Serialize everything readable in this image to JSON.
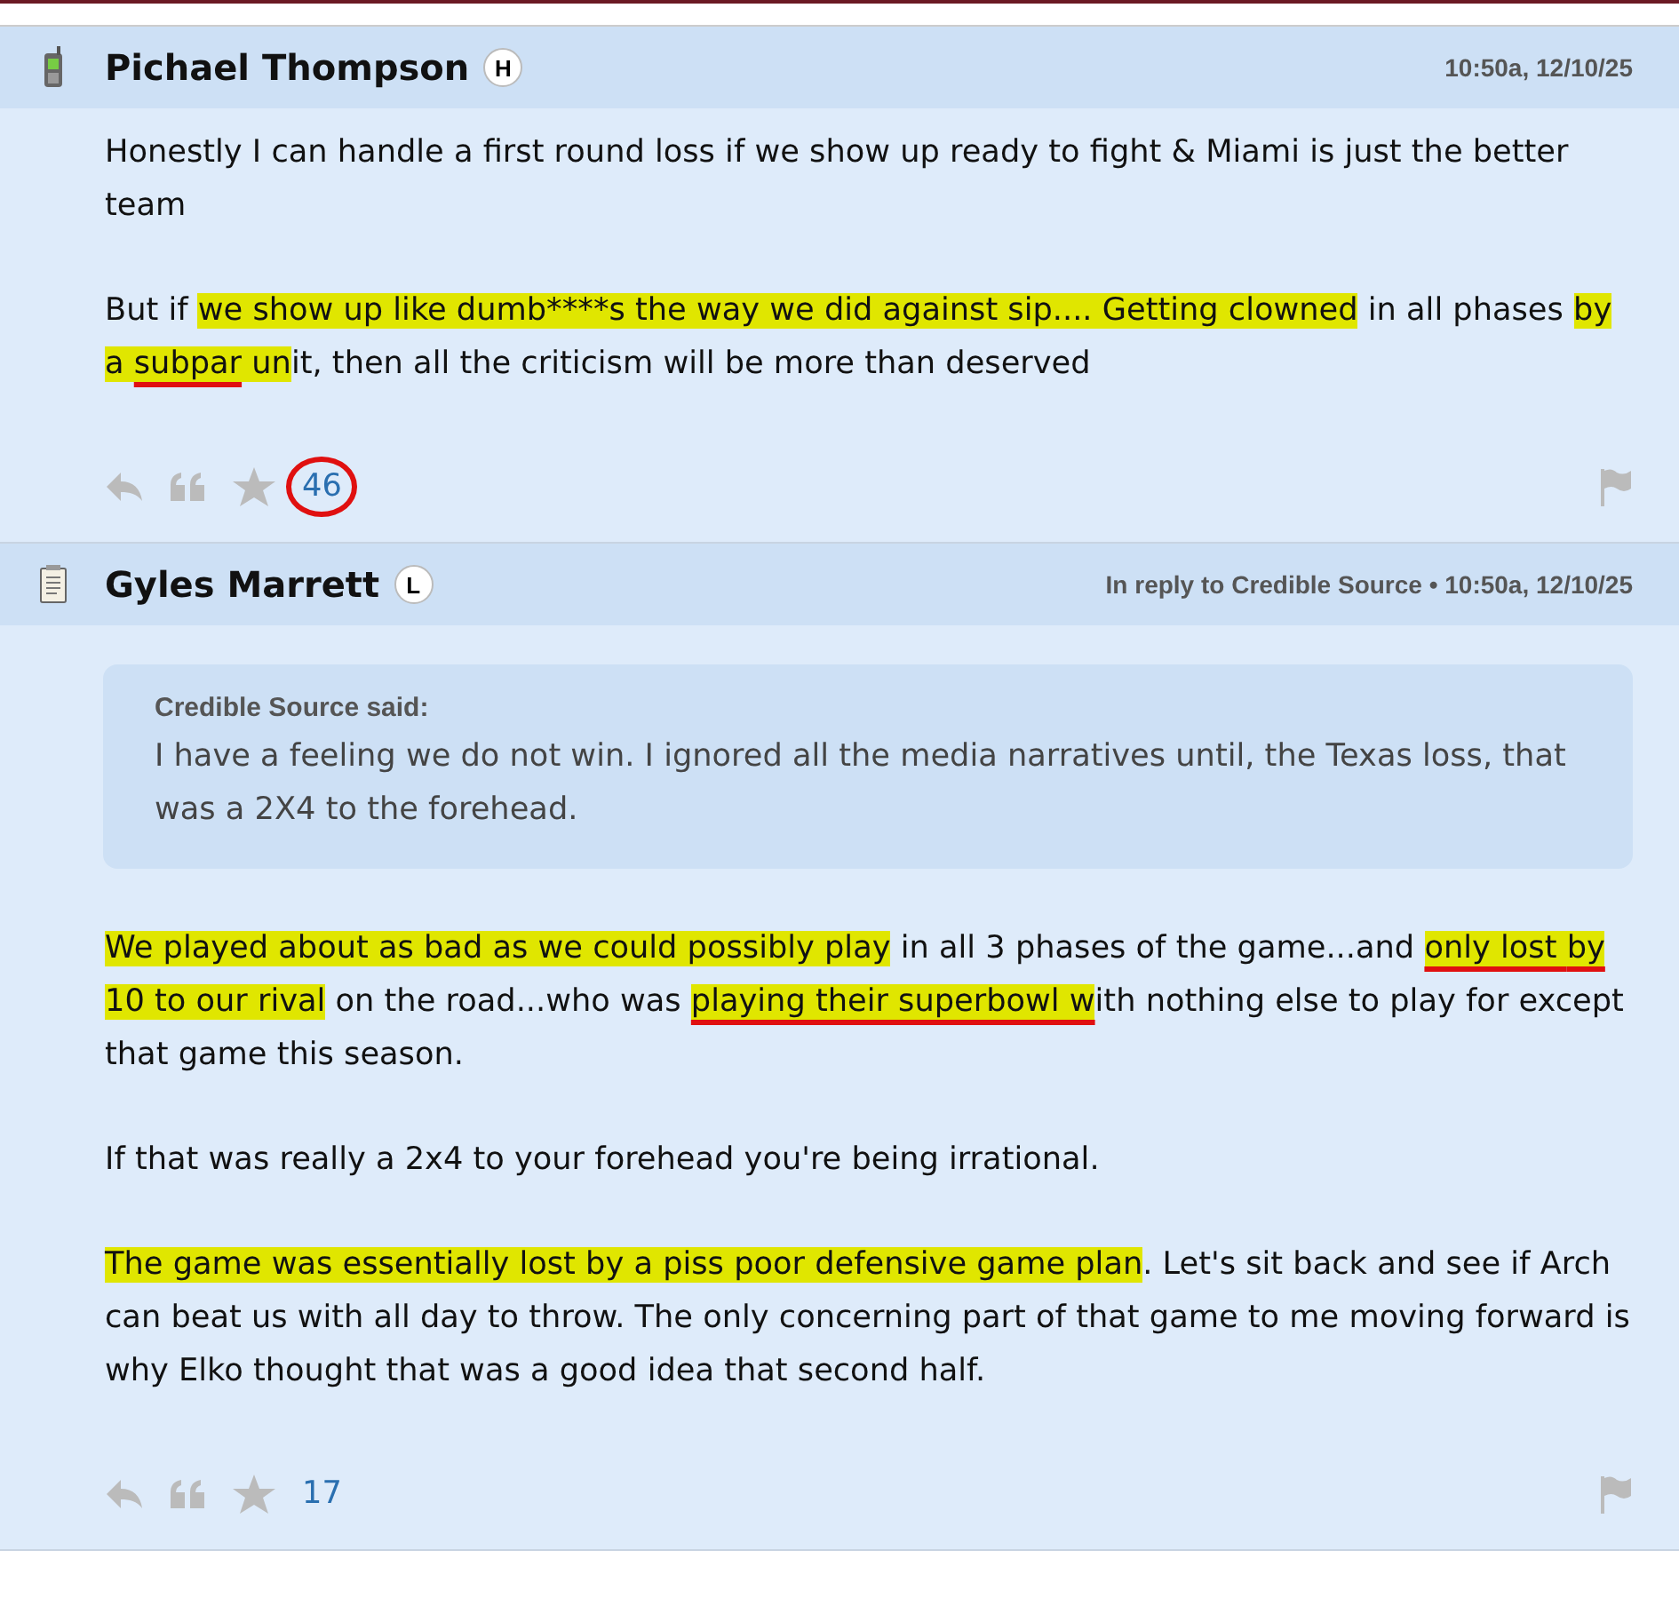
{
  "posts": [
    {
      "kind": "phone",
      "author": "Pichael Thompson",
      "badge": "H",
      "meta": "10:50a, 12/10/25",
      "paragraphs": [
        [
          {
            "text": "Honestly I can handle a first round loss if we show up ready to fight & Miami is just the better team",
            "highlight": false,
            "underline": false
          }
        ],
        [
          {
            "text": "But if ",
            "highlight": false,
            "underline": false
          },
          {
            "text": "we show up like dumb****s the way we did against sip.... ",
            "highlight": true,
            "underline": false
          },
          {
            "text": "Getting clowned",
            "highlight": true,
            "underline": false
          },
          {
            "text": " in all phases ",
            "highlight": false,
            "underline": false
          },
          {
            "text": "by a ",
            "highlight": true,
            "underline": false
          },
          {
            "text": "subpar",
            "highlight": true,
            "underline": true
          },
          {
            "text": " un",
            "highlight": true,
            "underline": false
          },
          {
            "text": "it, then all the criticism will be more than deserved",
            "highlight": false,
            "underline": false
          }
        ]
      ],
      "likes": "46",
      "circled": true
    },
    {
      "kind": "notepad",
      "author": "Gyles Marrett",
      "badge": "L",
      "meta": "In reply to Credible Source • 10:50a, 12/10/25",
      "quote": {
        "author": "Credible Source said:",
        "text": "I have a feeling we do not win. I ignored all the media narratives until, the Texas loss, that was a 2X4 to the forehead."
      },
      "paragraphs": [
        [
          {
            "text": "We played about as bad as we could possibly play",
            "highlight": true,
            "underline": false
          },
          {
            "text": " in all 3 phases of the game...and ",
            "highlight": false,
            "underline": false
          },
          {
            "text": "only lost ",
            "highlight": true,
            "underline": true
          },
          {
            "text": "by",
            "highlight": true,
            "underline": true
          },
          {
            "text": " 10 to our rival",
            "highlight": true,
            "underline": false
          },
          {
            "text": " on the road...who was ",
            "highlight": false,
            "underline": false
          },
          {
            "text": "playing their superbowl w",
            "highlight": true,
            "underline": true
          },
          {
            "text": "ith nothing else to play for except that game this season.",
            "highlight": false,
            "underline": false
          }
        ],
        [
          {
            "text": "If that was really a 2x4 to your forehead you're being irrational.",
            "highlight": false,
            "underline": false
          }
        ],
        [
          {
            "text": "The game was essentially lost by a piss poor defensive game plan",
            "highlight": true,
            "underline": false
          },
          {
            "text": ". Let's sit back and see if Arch can beat us with all day to throw. The only concerning part of that game to me moving forward is why Elko thought that was a good idea that second half.",
            "highlight": false,
            "underline": false
          }
        ]
      ],
      "likes": "17",
      "circled": false
    }
  ]
}
